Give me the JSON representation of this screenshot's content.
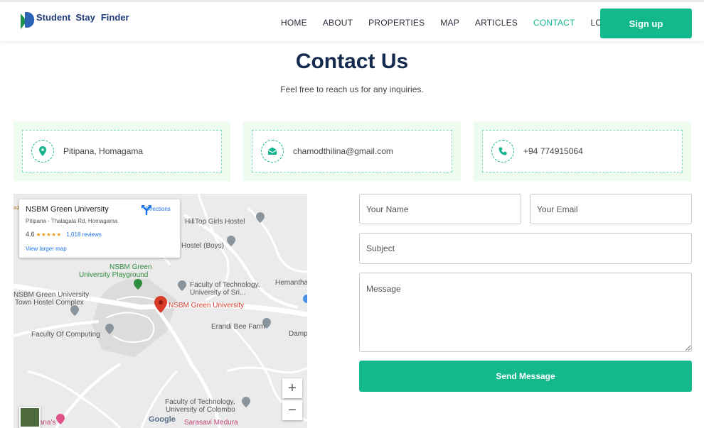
{
  "brand": {
    "name_1": "Student",
    "name_2": "Stay",
    "name_3": "Finder"
  },
  "nav": {
    "home": "HOME",
    "about": "ABOUT",
    "properties": "PROPERTIES",
    "map": "MAP",
    "articles": "ARTICLES",
    "contact": "CONTACT",
    "login": "LOGIN",
    "signup": "Sign up",
    "active_color": "#13b48e"
  },
  "header": {
    "title": "Contact Us",
    "subtitle": "Feel free to reach us for any inquiries."
  },
  "contact_cards": [
    {
      "icon": "location-pin-icon",
      "text": "Pitipana, Homagama"
    },
    {
      "icon": "envelope-icon",
      "text": "chamodthilina@gmail.com"
    },
    {
      "icon": "phone-icon",
      "text": "+94 774915064"
    }
  ],
  "map": {
    "place_name": "NSBM Green University",
    "place_address": "Pitipana - Thalagala Rd, Homagama",
    "rating": "4.6",
    "stars": "★★★★★",
    "reviews": "1,018 reviews",
    "directions": "Directions",
    "view_larger": "View larger map",
    "labels": {
      "hilltop": "HillTop Girls Hostel",
      "hostel_boys": "Hostel (Boys)",
      "playground_1": "NSBM Green",
      "playground_2": "University Playground",
      "fot_1": "Faculty of Technology,",
      "fot_2": "University of Sri...",
      "hemantha": "Hemantha",
      "town_hostel_1": "NSBM Green University",
      "town_hostel_2": "Town Hostel Complex",
      "nsbm_pin": "NSBM Green University",
      "computing": "Faculty Of Computing",
      "erandi": "Erandi Bee Farm",
      "damp": "Damp",
      "foc_colombo_1": "Faculty of Technology,",
      "foc_colombo_2": "University of Colombo",
      "sarasavi": "Sarasavi Medura",
      "left_edge": "ipana's",
      "top_edge": "az",
      "google": "Google"
    },
    "zoom_in": "+",
    "zoom_out": "−"
  },
  "form": {
    "name_placeholder": "Your Name",
    "email_placeholder": "Your Email",
    "subject_placeholder": "Subject",
    "message_placeholder": "Message",
    "send_label": "Send Message"
  },
  "colors": {
    "accent": "#13b98d",
    "title": "#152a4f",
    "card_bg": "#eefcf0"
  }
}
